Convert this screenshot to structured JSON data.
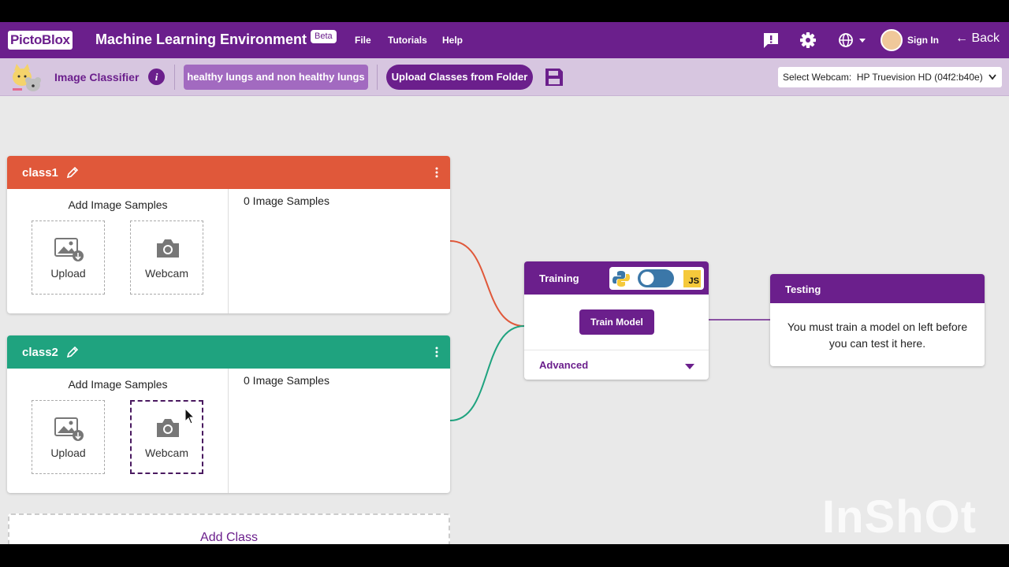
{
  "header": {
    "logo": "PictoBlox",
    "title": "Machine Learning Environment",
    "badge": "Beta",
    "menu": [
      "File",
      "Tutorials",
      "Help"
    ],
    "sign_in": "Sign In",
    "back": "Back"
  },
  "toolbar": {
    "label": "Image Classifier",
    "project_name": "healthy lungs and non healthy lungs",
    "upload_folder": "Upload Classes from Folder",
    "webcam_label": "Select Webcam:",
    "webcam_value": "HP Truevision HD (04f2:b40e)"
  },
  "classes": [
    {
      "name": "class1",
      "color": "#e0583a",
      "add_title": "Add Image Samples",
      "upload_label": "Upload",
      "webcam_label": "Webcam",
      "sample_count": "0 Image Samples"
    },
    {
      "name": "class2",
      "color": "#1fa37f",
      "add_title": "Add Image Samples",
      "upload_label": "Upload",
      "webcam_label": "Webcam",
      "sample_count": "0 Image Samples"
    }
  ],
  "add_class": "Add Class",
  "training": {
    "title": "Training",
    "js_badge": "JS",
    "train_button": "Train Model",
    "advanced": "Advanced"
  },
  "testing": {
    "title": "Testing",
    "message": "You must train a model on left before you can test it here."
  },
  "watermark": "InShOt",
  "colors": {
    "primary": "#6b1f8c",
    "class1": "#e0583a",
    "class2": "#1fa37f"
  }
}
